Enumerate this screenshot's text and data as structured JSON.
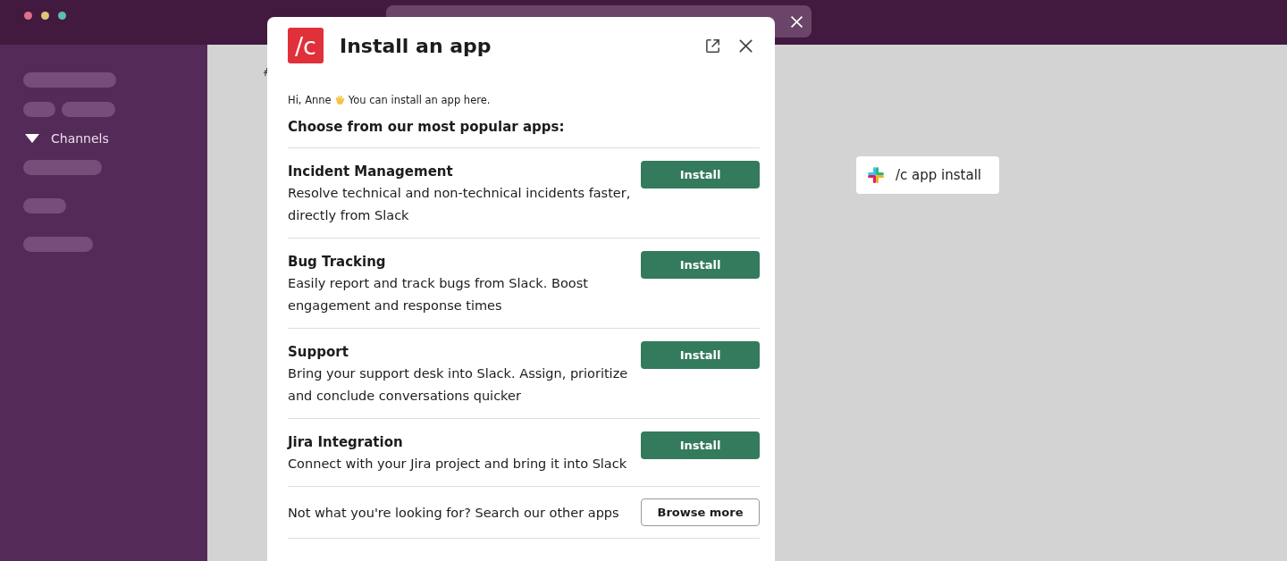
{
  "window": {
    "controls": [
      {
        "color": "#e0708a"
      },
      {
        "color": "#e3c27a"
      },
      {
        "color": "#5fbcb0"
      }
    ]
  },
  "sidebar": {
    "section": {
      "label": "Channels",
      "expanded": true
    }
  },
  "channel_header": {
    "fragment": "#"
  },
  "command_chip": {
    "label": "/c app install"
  },
  "modal": {
    "logo": "/c",
    "title": "Install an app",
    "greeting": {
      "before": "Hi, Anne",
      "after": "You can install an app here."
    },
    "intro": "Choose from our most popular apps:",
    "apps": [
      {
        "name": "Incident Management",
        "description": "Resolve technical and non-technical incidents faster, directly from Slack",
        "action": "Install"
      },
      {
        "name": "Bug Tracking",
        "description": "Easily report and track bugs from Slack. Boost engagement and response times",
        "action": "Install"
      },
      {
        "name": "Support",
        "description": "Bring your support desk into Slack. Assign, prioritize and conclude conversations quicker",
        "action": "Install"
      },
      {
        "name": "Jira Integration",
        "description": "Connect with your Jira project and bring it into Slack",
        "action": "Install"
      }
    ],
    "footer": {
      "text": "Not what you're looking for? Search our other apps",
      "action": "Browse more"
    }
  }
}
